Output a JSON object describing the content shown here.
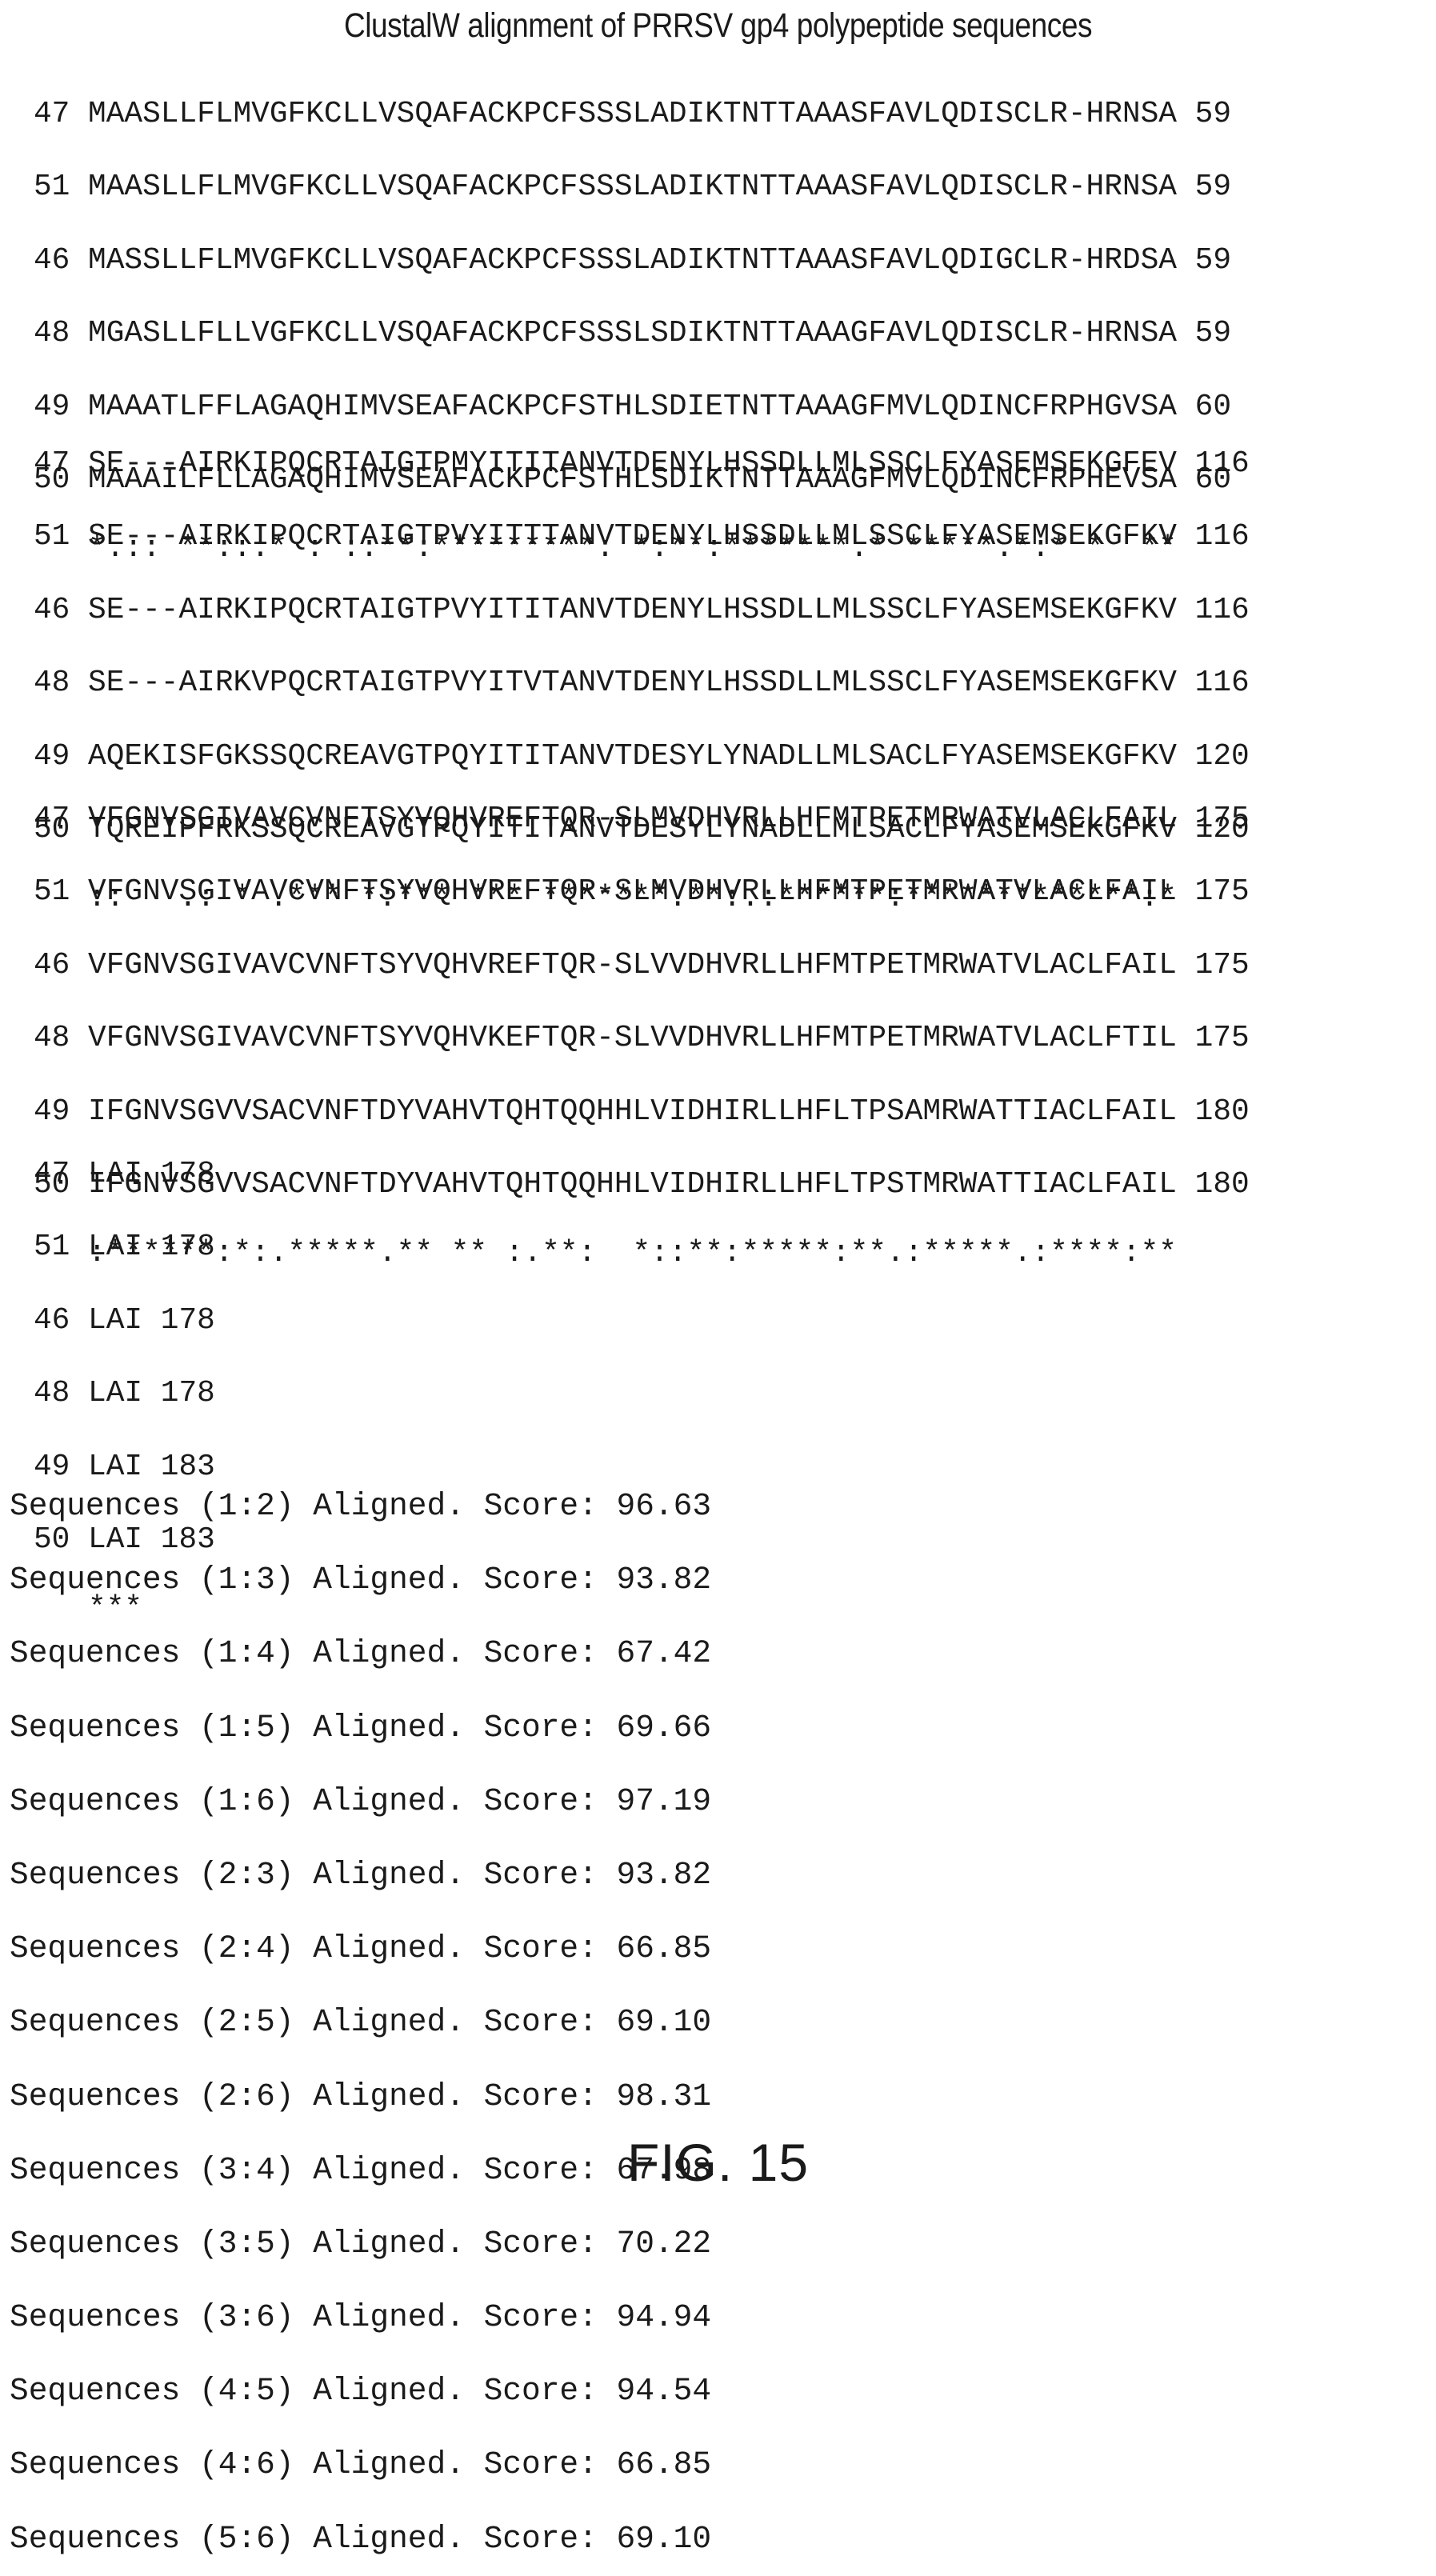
{
  "title": "ClustalW alignment of PRRSV gp4 polypeptide sequences",
  "blocks": [
    {
      "rows": [
        "47 MAASLLFLMVGFKCLLVSQAFACKPCFSSSLADIKTNTTAAASFAVLQDISCLR-HRNSA 59",
        "51 MAASLLFLMVGFKCLLVSQAFACKPCFSSSLADIKTNTTAAASFAVLQDISCLR-HRNSA 59",
        "46 MASSLLFLMVGFKCLLVSQAFACKPCFSSSLADIKTNTTAAASFAVLQDIGCLR-HRDSA 59",
        "48 MGASLLFLLVGFKCLLVSQAFACKPCFSSSLSDIKTNTTAAAGFAVLQDISCLR-HRNSA 59",
        "49 MAAATLFFLAGAQHIMVSEAFACKPCFSTHLSDIETNTTAAAGFMVLQDINCFRPHGVSA 60",
        "50 MAAAILFLLAGAQHIMVSEAFACKPCFSTHLSDIKTNTTAAAGFMVLQDINCFRPHEVSA 60"
      ],
      "consensus": "   *.:: **::.* : ::**:*********: *:**:*******.* *****.*:* *  **"
    },
    {
      "rows": [
        "47 SE---AIRKIPQCRTAIGTPMYITITANVTDENYLHSSDLLMLSSCLFYASEMSEKGFEV 116",
        "51 SE---AIRKIPQCRTAIGTPVYITTTANVTDENYLHSSDLLMLSSCLFYASEMSEKGFKV 116",
        "46 SE---AIRKIPQCRTAIGTPVYITITANVTDENYLHSSDLLMLSSCLFYASEMSEKGFKV 116",
        "48 SE---AIRKVPQCRTAIGTPVYITVTANVTDENYLHSSDLLMLSSCLFYASEMSEKGFKV 116",
        "49 AQEKISFGKSSQCREAVGTPQYITITANVTDESYLYNADLLMLSACLFYASEMSEKGFKV 120",
        "50 TQREIPFRKSSQCREAVGTPQYITITANVTDESYLYNADLLMLSACLFYASEMSEKGFKV 120"
      ],
      "consensus": "   ::   .: * .*** *:*** *** *******.**:.:******:*************:*"
    },
    {
      "rows": [
        "47 VFGNVSGIVAVCVNFTSYVQHVREFTQR-SLMVDHVRLLHFMTPETMRWATVLACLFAIL 175",
        "51 VFGNVSGIVAVCVNFTSYVQHVREFTQR-SLMVDHVRLLHFMTPETMRWATVLACLFAIL 175",
        "46 VFGNVSGIVAVCVNFTSYVQHVREFTQR-SLVVDHVRLLHFMTPETMRWATVLACLFAIL 175",
        "48 VFGNVSGIVAVCVNFTSYVQHVKEFTQR-SLVVDHVRLLHFMTPETMRWATVLACLFTIL 175",
        "49 IFGNVSGVVSACVNFTDYVAHVTQHTQQHHLVIDHIRLLHFLTPSAMRWATTIACLFAIL 180",
        "50 IFGNVSGVVSACVNFTDYVAHVTQHTQQHHLVIDHIRLLHFLTPSTMRWATTIACLFAIL 180"
      ],
      "consensus": "   :******:*:.*****.** ** :.**:  *::**:*****:**.:*****.:****:**"
    },
    {
      "rows": [
        "47 LAI 178",
        "51 LAI 178",
        "46 LAI 178",
        "48 LAI 178",
        "49 LAI 183",
        "50 LAI 183"
      ],
      "consensus": "   ***"
    }
  ],
  "scores": [
    "Sequences (1:2) Aligned. Score: 96.63",
    "Sequences (1:3) Aligned. Score: 93.82",
    "Sequences (1:4) Aligned. Score: 67.42",
    "Sequences (1:5) Aligned. Score: 69.66",
    "Sequences (1:6) Aligned. Score: 97.19",
    "Sequences (2:3) Aligned. Score: 93.82",
    "Sequences (2:4) Aligned. Score: 66.85",
    "Sequences (2:5) Aligned. Score: 69.10",
    "Sequences (2:6) Aligned. Score: 98.31",
    "Sequences (3:4) Aligned. Score: 67.98",
    "Sequences (3:5) Aligned. Score: 70.22",
    "Sequences (3:6) Aligned. Score: 94.94",
    "Sequences (4:5) Aligned. Score: 94.54",
    "Sequences (4:6) Aligned. Score: 66.85",
    "Sequences (5:6) Aligned. Score: 69.10"
  ],
  "caption": "FIG. 15"
}
